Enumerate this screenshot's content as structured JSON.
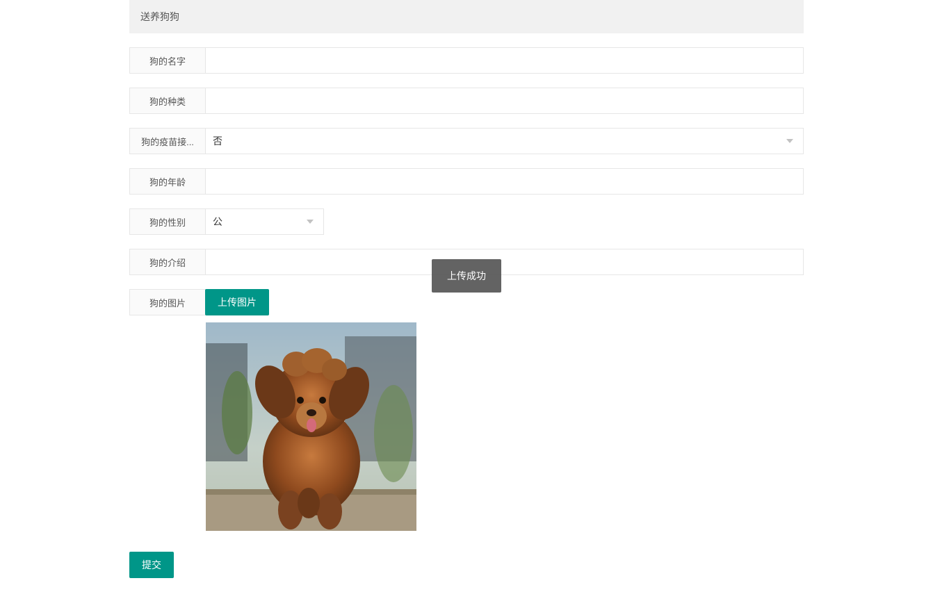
{
  "panel": {
    "title": "送养狗狗"
  },
  "form": {
    "name": {
      "label": "狗的名字",
      "value": ""
    },
    "breed": {
      "label": "狗的种类",
      "value": ""
    },
    "vaccine": {
      "label": "狗的疫苗接...",
      "selected": "否"
    },
    "age": {
      "label": "狗的年龄",
      "value": ""
    },
    "sex": {
      "label": "狗的性别",
      "selected": "公"
    },
    "intro": {
      "label": "狗的介绍",
      "value": ""
    },
    "image": {
      "label": "狗的图片",
      "upload_button": "上传图片"
    }
  },
  "submit": {
    "label": "提交"
  },
  "toast": {
    "message": "上传成功"
  }
}
